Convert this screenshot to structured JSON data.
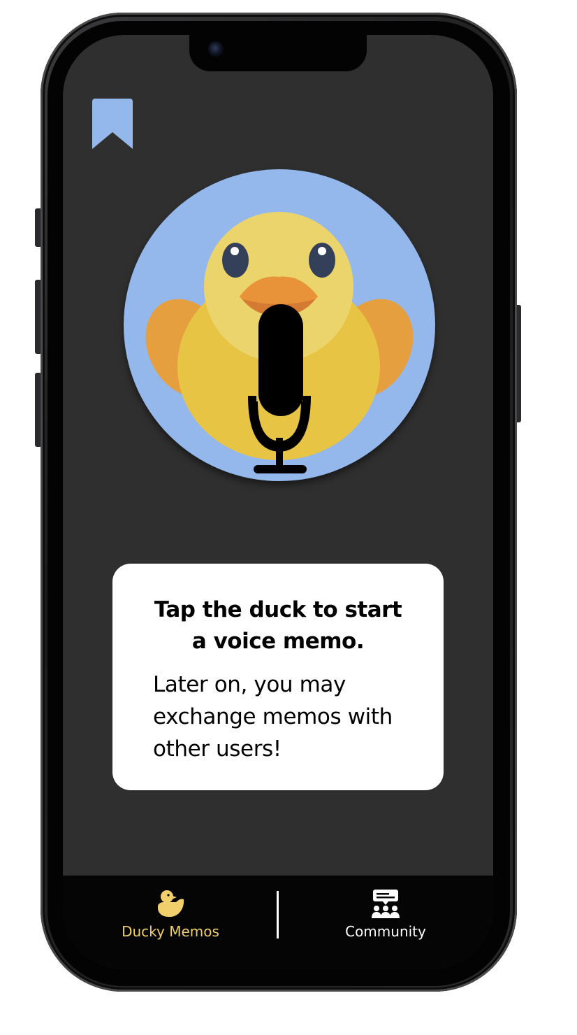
{
  "card": {
    "title": "Tap the duck to start a voice memo.",
    "body": "Later on, you may exchange memos with other users!"
  },
  "tabs": [
    {
      "label": "Ducky Memos",
      "icon": "duck-icon",
      "active": true
    },
    {
      "label": "Community",
      "icon": "community-icon",
      "active": false
    }
  ],
  "icons": {
    "bookmark": "bookmark-icon",
    "record": "microphone-icon",
    "mascot": "duck-mascot"
  },
  "colors": {
    "screen_bg": "#2f2f2f",
    "accent_blue": "#94b8ec",
    "duck_yellow": "#e8c444",
    "duck_head": "#ecd46c",
    "duck_wing": "#e69f3e",
    "beak": "#e8923a",
    "active_tab": "#f0cf6c",
    "tabbar_bg": "#050505"
  }
}
